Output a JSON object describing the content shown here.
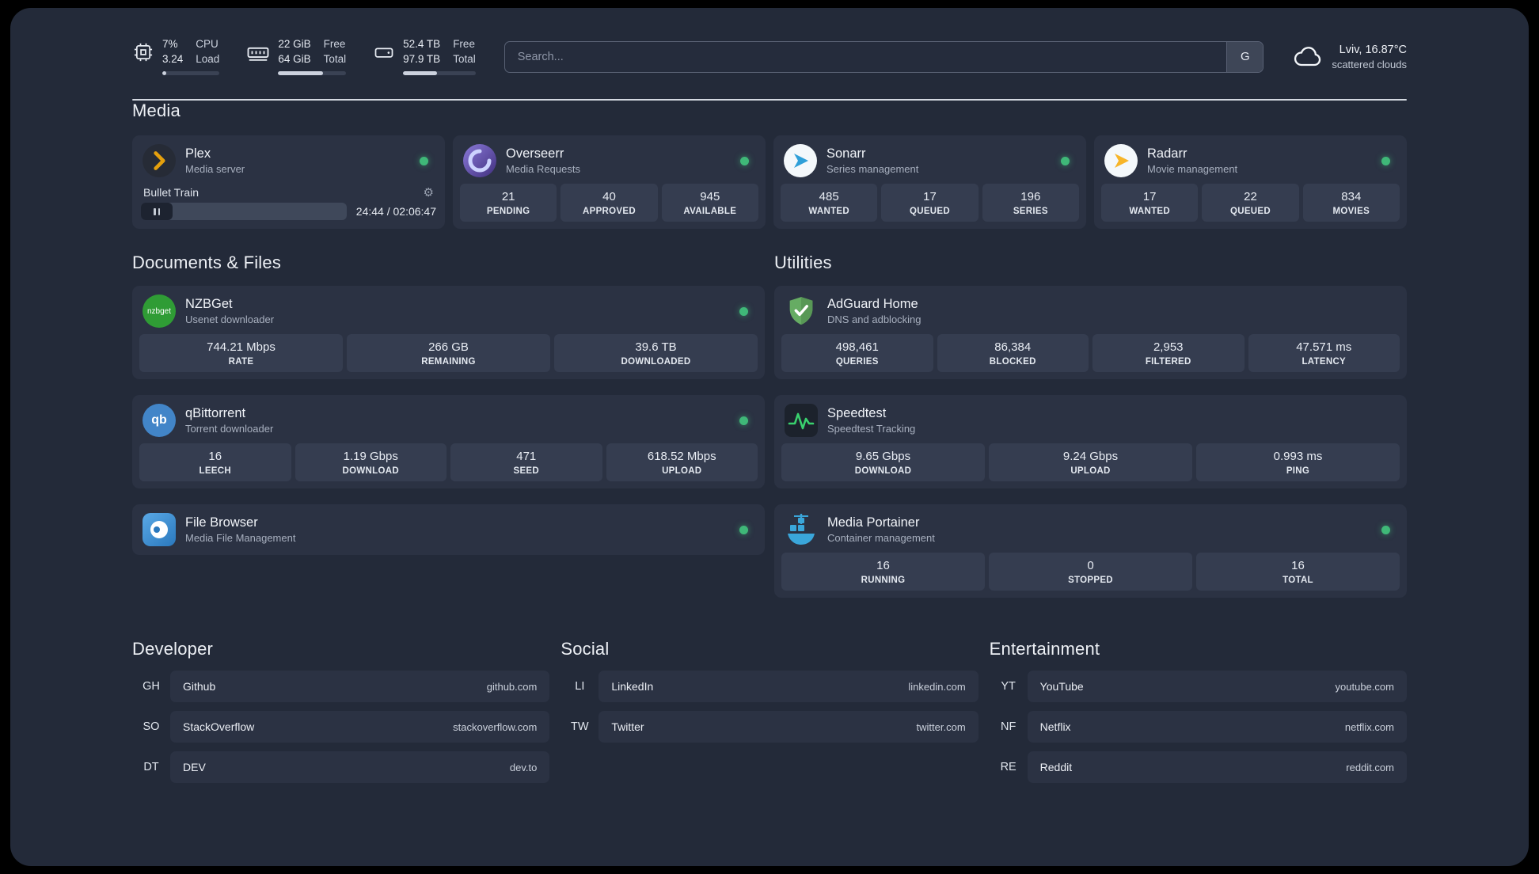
{
  "colors": {
    "page_background": "#232a39",
    "card_background": "#2b3243",
    "stat_tile_background": "#353d50",
    "status_online": "#3fb878",
    "plex_accent": "#e5a00d",
    "sonarr_accent": "#2f9fd8",
    "radarr_accent": "#f7b529",
    "adguard_green": "#66ac63",
    "speedtest_green": "#39d16e",
    "portainer_blue": "#3aa6da"
  },
  "icons": {
    "cpu": "cpu-chip-icon",
    "memory": "memory-icon",
    "disk": "disk-icon",
    "weather": "cloud-icon",
    "gear": "⚙",
    "nzbget_text": "nzbget",
    "qbittorrent_text": "qb"
  },
  "topbar": {
    "cpu": {
      "value": "7%",
      "sub": "3.24",
      "label_top": "CPU",
      "label_bottom": "Load",
      "percent": 7
    },
    "ram": {
      "value": "22 GiB",
      "sub": "64 GiB",
      "label_top": "Free",
      "label_bottom": "Total",
      "percent": 66
    },
    "disk": {
      "value": "52.4 TB",
      "sub": "97.9 TB",
      "label_top": "Free",
      "label_bottom": "Total",
      "percent": 47
    },
    "search": {
      "placeholder": "Search...",
      "button_label": "G",
      "value": ""
    },
    "weather": {
      "location": "Lviv, 16.87°C",
      "condition": "scattered clouds"
    }
  },
  "sections": {
    "media": "Media",
    "documents": "Documents & Files",
    "utilities": "Utilities",
    "developer": "Developer",
    "social": "Social",
    "entertainment": "Entertainment"
  },
  "apps": {
    "plex": {
      "name": "Plex",
      "desc": "Media server",
      "now_playing": "Bullet Train",
      "time": "24:44 / 02:06:47",
      "status": "online"
    },
    "overseerr": {
      "name": "Overseerr",
      "desc": "Media Requests",
      "status": "online",
      "stats": [
        {
          "value": "21",
          "label": "PENDING"
        },
        {
          "value": "40",
          "label": "APPROVED"
        },
        {
          "value": "945",
          "label": "AVAILABLE"
        }
      ]
    },
    "sonarr": {
      "name": "Sonarr",
      "desc": "Series management",
      "status": "online",
      "stats": [
        {
          "value": "485",
          "label": "WANTED"
        },
        {
          "value": "17",
          "label": "QUEUED"
        },
        {
          "value": "196",
          "label": "SERIES"
        }
      ]
    },
    "radarr": {
      "name": "Radarr",
      "desc": "Movie management",
      "status": "online",
      "stats": [
        {
          "value": "17",
          "label": "WANTED"
        },
        {
          "value": "22",
          "label": "QUEUED"
        },
        {
          "value": "834",
          "label": "MOVIES"
        }
      ]
    },
    "nzbget": {
      "name": "NZBGet",
      "desc": "Usenet downloader",
      "status": "online",
      "stats": [
        {
          "value": "744.21 Mbps",
          "label": "RATE"
        },
        {
          "value": "266 GB",
          "label": "REMAINING"
        },
        {
          "value": "39.6 TB",
          "label": "DOWNLOADED"
        }
      ]
    },
    "qbittorrent": {
      "name": "qBittorrent",
      "desc": "Torrent downloader",
      "status": "online",
      "stats": [
        {
          "value": "16",
          "label": "LEECH"
        },
        {
          "value": "1.19 Gbps",
          "label": "DOWNLOAD"
        },
        {
          "value": "471",
          "label": "SEED"
        },
        {
          "value": "618.52 Mbps",
          "label": "UPLOAD"
        }
      ]
    },
    "filebrowser": {
      "name": "File Browser",
      "desc": "Media File Management",
      "status": "online"
    },
    "adguard": {
      "name": "AdGuard Home",
      "desc": "DNS and adblocking",
      "stats": [
        {
          "value": "498,461",
          "label": "QUERIES"
        },
        {
          "value": "86,384",
          "label": "BLOCKED"
        },
        {
          "value": "2,953",
          "label": "FILTERED"
        },
        {
          "value": "47.571 ms",
          "label": "LATENCY"
        }
      ]
    },
    "speedtest": {
      "name": "Speedtest",
      "desc": "Speedtest Tracking",
      "stats": [
        {
          "value": "9.65 Gbps",
          "label": "DOWNLOAD"
        },
        {
          "value": "9.24 Gbps",
          "label": "UPLOAD"
        },
        {
          "value": "0.993 ms",
          "label": "PING"
        }
      ]
    },
    "portainer": {
      "name": "Media Portainer",
      "desc": "Container management",
      "status": "online",
      "stats": [
        {
          "value": "16",
          "label": "RUNNING"
        },
        {
          "value": "0",
          "label": "STOPPED"
        },
        {
          "value": "16",
          "label": "TOTAL"
        }
      ]
    }
  },
  "bookmarks": {
    "developer": [
      {
        "abbr": "GH",
        "name": "Github",
        "url": "github.com"
      },
      {
        "abbr": "SO",
        "name": "StackOverflow",
        "url": "stackoverflow.com"
      },
      {
        "abbr": "DT",
        "name": "DEV",
        "url": "dev.to"
      }
    ],
    "social": [
      {
        "abbr": "LI",
        "name": "LinkedIn",
        "url": "linkedin.com"
      },
      {
        "abbr": "TW",
        "name": "Twitter",
        "url": "twitter.com"
      }
    ],
    "entertainment": [
      {
        "abbr": "YT",
        "name": "YouTube",
        "url": "youtube.com"
      },
      {
        "abbr": "NF",
        "name": "Netflix",
        "url": "netflix.com"
      },
      {
        "abbr": "RE",
        "name": "Reddit",
        "url": "reddit.com"
      }
    ]
  }
}
